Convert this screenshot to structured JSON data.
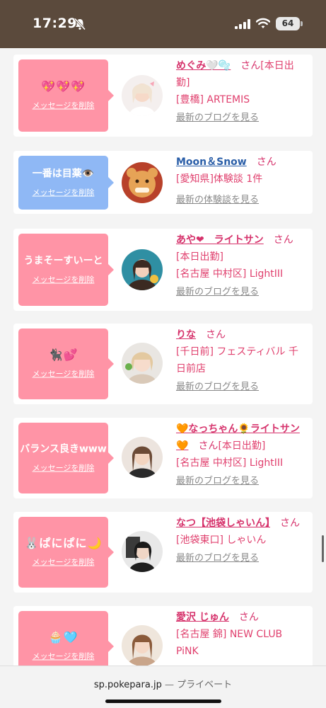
{
  "status": {
    "time": "17:29",
    "battery": "64"
  },
  "browser": {
    "domain": "sp.pokepara.jp",
    "separator": "—",
    "mode": "プライベート"
  },
  "cards": [
    {
      "message": "💖💖💖",
      "delete_label": "メッセージを削除",
      "name": "めぐみ🤍🫧",
      "suffix": "さん",
      "lines": [
        "[本日出勤]",
        "[豊橋] ARTEMIS"
      ],
      "more_label": "最新のブログを見る"
    },
    {
      "message": "一番は目薬👁️",
      "delete_label": "メッセージを削除",
      "name": "Moon＆Snow",
      "suffix": "さん",
      "lines": [
        "[愛知県]体験談 1件"
      ],
      "more_label": "最新の体験談を見る"
    },
    {
      "message": "うまそーすいーと",
      "delete_label": "メッセージを削除",
      "name": "あや❤　ライトサン",
      "suffix": "さん",
      "lines": [
        "[本日出勤]",
        "[名古屋 中村区] LightIII"
      ],
      "more_label": "最新のブログを見る"
    },
    {
      "message": "🐈‍⬛💕",
      "delete_label": "メッセージを削除",
      "name": "りな",
      "suffix": "さん",
      "lines": [
        "[千日前] フェスティバル 千日前店"
      ],
      "more_label": "最新のブログを見る"
    },
    {
      "message": "バランス良きwww",
      "delete_label": "メッセージを削除",
      "name": "🧡なっちゃん🌻ライトサン🧡",
      "suffix": "さん",
      "lines": [
        "[本日出勤]",
        "[名古屋 中村区] LightIII"
      ],
      "more_label": "最新のブログを見る"
    },
    {
      "message": "🐰ぱにぱに🌙",
      "delete_label": "メッセージを削除",
      "name": "なつ【池袋しゃいん】",
      "suffix": "さん",
      "lines": [
        "[池袋東口] しゃいん"
      ],
      "more_label": "最新のブログを見る"
    },
    {
      "message": "🧁🩵",
      "delete_label": "メッセージを削除",
      "name": "愛沢 じゅん",
      "suffix": "さん",
      "lines": [
        "[名古屋 錦] NEW CLUB PiNK"
      ],
      "more_label": ""
    }
  ]
}
